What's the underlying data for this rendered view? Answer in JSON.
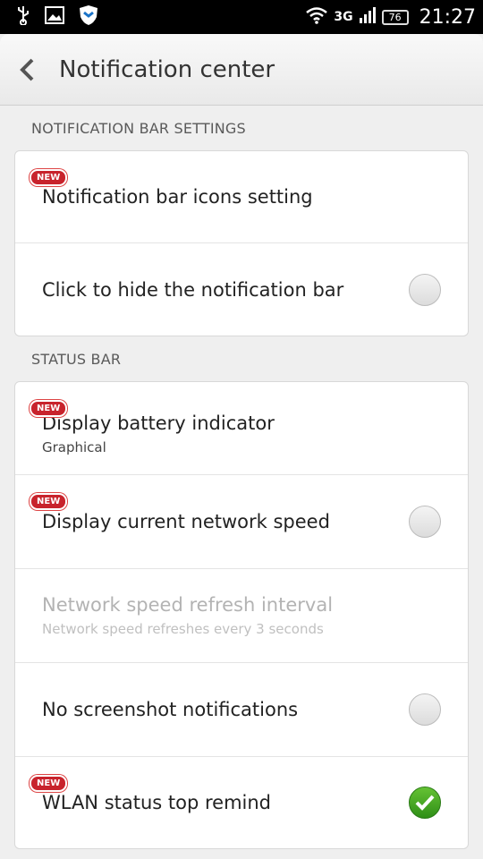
{
  "status_bar": {
    "network": "3G",
    "battery": "76",
    "time": "21:27"
  },
  "header": {
    "title": "Notification center"
  },
  "sections": [
    {
      "label": "NOTIFICATION BAR SETTINGS",
      "rows": [
        {
          "title": "Notification bar icons setting",
          "badge": "NEW"
        },
        {
          "title": "Click to hide the notification bar",
          "checked": false
        }
      ]
    },
    {
      "label": "STATUS BAR",
      "rows": [
        {
          "title": "Display battery indicator",
          "subtitle": "Graphical",
          "badge": "NEW"
        },
        {
          "title": "Display current network speed",
          "badge": "NEW",
          "checked": false
        },
        {
          "title": "Network speed refresh interval",
          "subtitle": "Network speed refreshes every 3 seconds",
          "enabled": false
        },
        {
          "title": "No screenshot notifications",
          "checked": false
        },
        {
          "title": "WLAN status top remind",
          "badge": "NEW",
          "checked": true
        }
      ]
    }
  ],
  "colors": {
    "badge": "#c8232c",
    "checked": "#4caf2a"
  }
}
